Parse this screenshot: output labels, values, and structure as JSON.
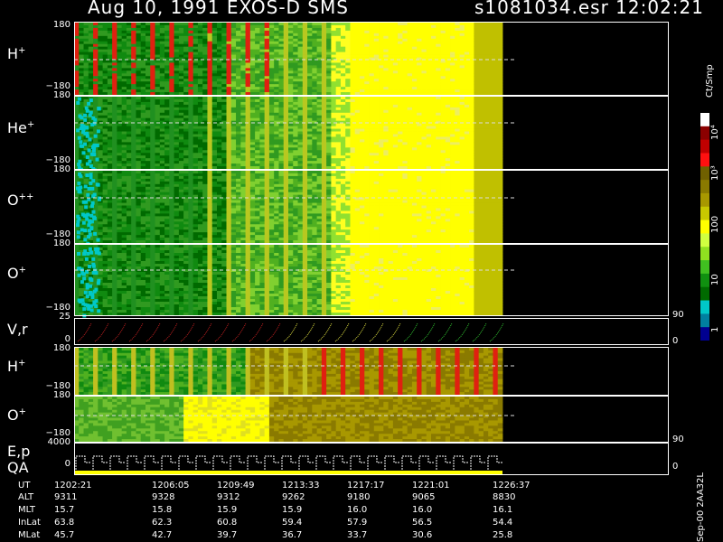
{
  "header": {
    "title_left": "Aug 10, 1991    EXOS-D SMS",
    "title_right": "s1081034.esr   12:02:21"
  },
  "panels": [
    {
      "id": "h",
      "label": "H",
      "sup": "+",
      "top": "180",
      "bottom": "−180"
    },
    {
      "id": "he",
      "label": "He",
      "sup": "+",
      "top": "180",
      "bottom": "−180"
    },
    {
      "id": "oo",
      "label": "O",
      "sup": "++",
      "top": "180",
      "bottom": "−180"
    },
    {
      "id": "o",
      "label": "O",
      "sup": "+",
      "top": "180",
      "bottom": "−180"
    },
    {
      "id": "vr",
      "label": "V,r",
      "sup": "",
      "top": "25",
      "bottom": "0",
      "right_top": "90",
      "right_bottom": "0"
    },
    {
      "id": "h2",
      "label": "H",
      "sup": "+",
      "top": "180",
      "bottom": "−180"
    },
    {
      "id": "o2",
      "label": "O",
      "sup": "+",
      "top": "180",
      "bottom": "−180"
    },
    {
      "id": "ep",
      "label": "E,p",
      "label2": "QA",
      "sup": "",
      "top": "4000",
      "bottom": "0",
      "right_top": "90",
      "right_bottom": "0"
    }
  ],
  "colorbar": {
    "unit": "Ct/Smp",
    "labels": [
      "10⁴",
      "10³",
      "100",
      "10",
      "1"
    ],
    "colors": [
      "#ffffff",
      "#8b0000",
      "#c00000",
      "#ff1010",
      "#706000",
      "#8a7a00",
      "#a89800",
      "#c8c800",
      "#ffff00",
      "#d0ff40",
      "#90e020",
      "#40c020",
      "#109010",
      "#006a00",
      "#00c8c8",
      "#0080a0",
      "#000090"
    ]
  },
  "ephemeris": {
    "rows": [
      {
        "name": "UT",
        "values": [
          "1202:21",
          "1206:05",
          "1209:49",
          "1213:33",
          "1217:17",
          "1221:01",
          "1226:37"
        ]
      },
      {
        "name": "ALT",
        "values": [
          "9311",
          "9328",
          "9312",
          "9262",
          "9180",
          "9065",
          "8830"
        ]
      },
      {
        "name": "MLT",
        "values": [
          "15.7",
          "15.8",
          "15.9",
          "15.9",
          "16.0",
          "16.0",
          "16.1"
        ]
      },
      {
        "name": "InLat",
        "values": [
          "63.8",
          "62.3",
          "60.8",
          "59.4",
          "57.9",
          "56.5",
          "54.4"
        ]
      },
      {
        "name": "MLat",
        "values": [
          "45.7",
          "42.7",
          "39.7",
          "36.7",
          "33.7",
          "30.6",
          "25.8"
        ]
      }
    ]
  },
  "stamp": "Sep-00  2AA32L",
  "chart_data": {
    "type": "heatmap",
    "title": "Aug 10, 1991    EXOS-D SMS",
    "x": [
      "1202:21",
      "1206:05",
      "1209:49",
      "1213:33",
      "1217:17",
      "1221:01",
      "1226:37"
    ],
    "series": [
      {
        "name": "H+",
        "ylim": [
          -180,
          180
        ]
      },
      {
        "name": "He+",
        "ylim": [
          -180,
          180
        ]
      },
      {
        "name": "O++",
        "ylim": [
          -180,
          180
        ]
      },
      {
        "name": "O+",
        "ylim": [
          -180,
          180
        ]
      },
      {
        "name": "V,r",
        "ylim": [
          0,
          25
        ]
      },
      {
        "name": "H+",
        "ylim": [
          -180,
          180
        ]
      },
      {
        "name": "O+",
        "ylim": [
          -180,
          180
        ]
      },
      {
        "name": "E,p",
        "ylim": [
          0,
          4000
        ]
      }
    ],
    "colorbar_ticks": [
      "1",
      "10",
      "100",
      "10³",
      "10⁴"
    ]
  }
}
